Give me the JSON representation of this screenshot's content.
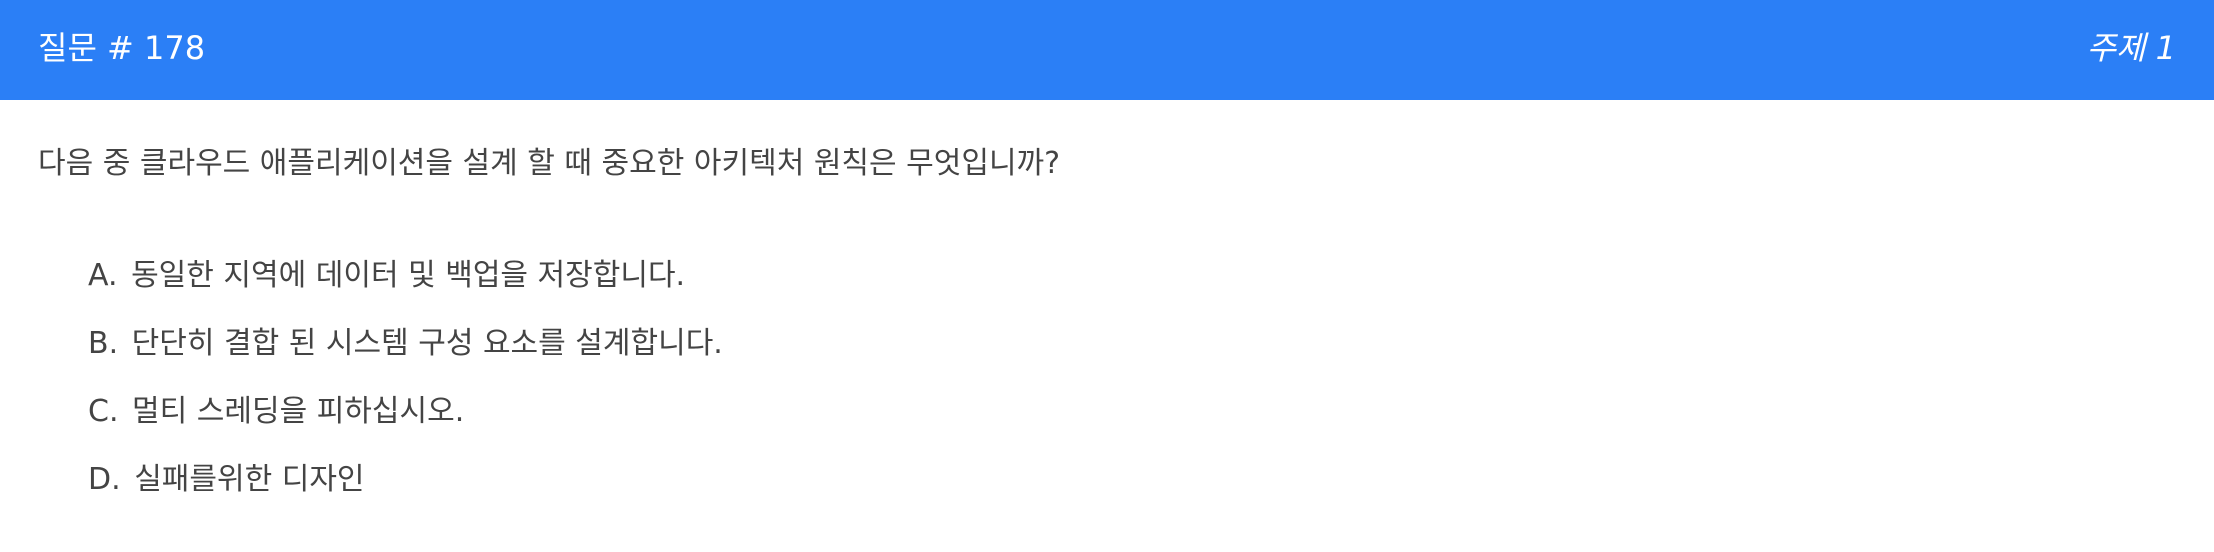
{
  "header": {
    "title": "질문 # 178",
    "topic": "주제 1",
    "background_color": "#2b7ff6"
  },
  "question": {
    "text": "다음 중 클라우드 애플리케이션을 설계 할 때 중요한 아키텍처 원칙은 무엇입니까?"
  },
  "options": [
    {
      "letter": "A.",
      "text": "동일한 지역에 데이터 및 백업을 저장합니다."
    },
    {
      "letter": "B.",
      "text": "단단히 결합 된 시스템 구성 요소를 설계합니다."
    },
    {
      "letter": "C.",
      "text": "멀티 스레딩을 피하십시오."
    },
    {
      "letter": "D.",
      "text": "실패를위한 디자인"
    }
  ]
}
